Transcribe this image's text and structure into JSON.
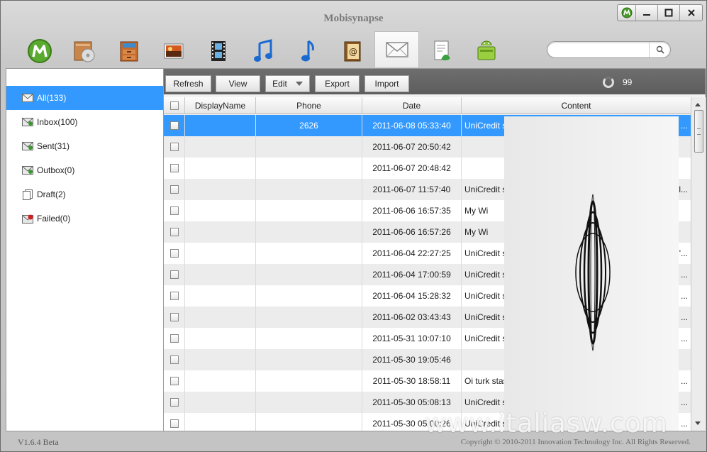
{
  "app": {
    "title": "Mobisynapse",
    "version": "V1.6.4 Beta",
    "copyright": "Copyright © 2010-2011 Innovation Technology Inc. All Rights Reserved.",
    "watermark": "www.italiasw.com"
  },
  "window_controls": [
    "app-logo-icon",
    "minimize-icon",
    "maximize-icon",
    "close-icon"
  ],
  "toolbar": {
    "items": [
      {
        "name": "home",
        "icon": "mobisynapse-logo-icon"
      },
      {
        "name": "applications",
        "icon": "box-disc-icon"
      },
      {
        "name": "files",
        "icon": "cabinet-icon"
      },
      {
        "name": "photos",
        "icon": "photo-icon"
      },
      {
        "name": "videos",
        "icon": "film-icon"
      },
      {
        "name": "music",
        "icon": "music-notes-icon"
      },
      {
        "name": "ringtones",
        "icon": "music-note-icon"
      },
      {
        "name": "contacts",
        "icon": "address-book-icon"
      },
      {
        "name": "messages",
        "icon": "envelope-icon",
        "active": true
      },
      {
        "name": "call-log",
        "icon": "phone-document-icon"
      },
      {
        "name": "android",
        "icon": "android-bag-icon"
      }
    ]
  },
  "search": {
    "placeholder": "",
    "value": ""
  },
  "sidebar": {
    "items": [
      {
        "label": "All(133)",
        "icon": "envelope-icon",
        "active": true
      },
      {
        "label": "Inbox(100)",
        "icon": "inbox-envelope-icon"
      },
      {
        "label": "Sent(31)",
        "icon": "sent-envelope-icon"
      },
      {
        "label": "Outbox(0)",
        "icon": "outbox-envelope-icon"
      },
      {
        "label": "Draft(2)",
        "icon": "draft-document-icon"
      },
      {
        "label": "Failed(0)",
        "icon": "failed-envelope-icon"
      }
    ]
  },
  "actions": {
    "refresh": "Refresh",
    "view": "View",
    "edit": "Edit",
    "export": "Export",
    "import": "Import",
    "count": "99"
  },
  "columns": {
    "display_name": "DisplayName",
    "phone": "Phone",
    "date": "Date",
    "content": "Content"
  },
  "messages": [
    {
      "name": "",
      "phone": "2626",
      "date": "2011-06-08 05:33:40",
      "content": "UniCredit se",
      "tail": "..."
    },
    {
      "name": "",
      "phone": "",
      "date": "2011-06-07 20:50:42",
      "content": "",
      "tail": ""
    },
    {
      "name": "",
      "phone": "",
      "date": "2011-06-07 20:48:42",
      "content": "",
      "tail": ""
    },
    {
      "name": "",
      "phone": "",
      "date": "2011-06-07 11:57:40",
      "content": "UniCredit se",
      "tail": "l..."
    },
    {
      "name": "",
      "phone": "",
      "date": "2011-06-06 16:57:35",
      "content": "My Wi",
      "tail": ""
    },
    {
      "name": "",
      "phone": "",
      "date": "2011-06-06 16:57:26",
      "content": "My Wi",
      "tail": ""
    },
    {
      "name": "",
      "phone": "",
      "date": "2011-06-04 22:27:25",
      "content": "UniCredit se",
      "tail": "'..."
    },
    {
      "name": "",
      "phone": "",
      "date": "2011-06-04 17:00:59",
      "content": "UniCredit se",
      "tail": "..."
    },
    {
      "name": "",
      "phone": "",
      "date": "2011-06-04 15:28:32",
      "content": "UniCredit se",
      "tail": "..."
    },
    {
      "name": "",
      "phone": "",
      "date": "2011-06-02 03:43:43",
      "content": "UniCredit se",
      "tail": "..."
    },
    {
      "name": "",
      "phone": "",
      "date": "2011-05-31 10:07:10",
      "content": "UniCredit se",
      "tail": "..."
    },
    {
      "name": "",
      "phone": "",
      "date": "2011-05-30 19:05:46",
      "content": "",
      "tail": ""
    },
    {
      "name": "",
      "phone": "",
      "date": "2011-05-30 18:58:11",
      "content": "Oi turk stase",
      "tail": "..."
    },
    {
      "name": "",
      "phone": "",
      "date": "2011-05-30 05:08:13",
      "content": "UniCredit se",
      "tail": "..."
    },
    {
      "name": "",
      "phone": "",
      "date": "2011-05-30 05:00:26",
      "content": "UniCredit se",
      "tail": "..."
    }
  ],
  "colors": {
    "selection": "#3399ff",
    "actionbar": "#666666"
  }
}
